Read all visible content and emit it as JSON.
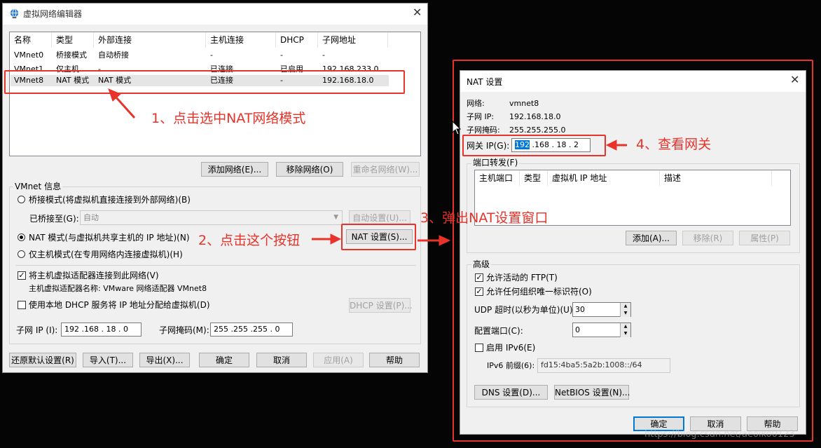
{
  "left_window": {
    "title": "虚拟网络编辑器",
    "columns": [
      "名称",
      "类型",
      "外部连接",
      "主机连接",
      "DHCP",
      "子网地址"
    ],
    "rows": [
      [
        "VMnet0",
        "桥接模式",
        "自动桥接",
        "-",
        "-",
        "-"
      ],
      [
        "VMnet1",
        "仅主机...",
        "-",
        "已连接",
        "已启用",
        "192.168.233.0"
      ],
      [
        "VMnet8",
        "NAT 模式",
        "NAT 模式",
        "已连接",
        "-",
        "192.168.18.0"
      ]
    ],
    "add_network": "添加网络(E)...",
    "remove_network": "移除网络(O)",
    "rename_network": "重命名网络(W)...",
    "vmnet_info": "VMnet 信息",
    "bridge_mode": "桥接模式(将虚拟机直接连接到外部网络)(B)",
    "bridged_to_label": "已桥接至(G):",
    "bridged_to_value": "自动",
    "auto_settings": "自动设置(U)...",
    "nat_mode": "NAT 模式(与虚拟机共享主机的 IP 地址)(N)",
    "nat_settings": "NAT 设置(S)...",
    "host_only": "仅主机模式(在专用网络内连接虚拟机)(H)",
    "connect_adapter": "将主机虚拟适配器连接到此网络(V)",
    "adapter_name": "主机虚拟适配器名称: VMware 网络适配器 VMnet8",
    "use_dhcp": "使用本地 DHCP 服务将 IP 地址分配给虚拟机(D)",
    "dhcp_settings": "DHCP 设置(P)...",
    "subnet_ip_label": "子网 IP (I):",
    "subnet_ip": "192 .168 . 18 . 0",
    "subnet_mask_label": "子网掩码(M):",
    "subnet_mask": "255 .255 .255 . 0",
    "restore": "还原默认设置(R)",
    "import": "导入(T)...",
    "export": "导出(X)...",
    "ok": "确定",
    "cancel": "取消",
    "apply": "应用(A)",
    "help": "帮助"
  },
  "nat_window": {
    "title": "NAT 设置",
    "network_label": "网络:",
    "network_value": "vmnet8",
    "subnet_ip_label": "子网 IP:",
    "subnet_ip_value": "192.168.18.0",
    "subnet_mask_label": "子网掩码:",
    "subnet_mask_value": "255.255.255.0",
    "gateway_label": "网关 IP(G):",
    "gateway_selected": "192",
    "gateway_rest": " .168 . 18  .  2",
    "port_forwarding": "端口转发(F)",
    "pf_columns": [
      "主机端口",
      "类型",
      "虚拟机 IP 地址",
      "描述"
    ],
    "add": "添加(A)...",
    "remove": "移除(R)",
    "properties": "属性(P)",
    "advanced": "高级",
    "allow_ftp": "允许活动的 FTP(T)",
    "allow_oui": "允许任何组织唯一标识符(O)",
    "udp_timeout_label": "UDP 超时(以秒为单位)(U):",
    "udp_timeout": "30",
    "config_port_label": "配置端口(C):",
    "config_port": "0",
    "enable_ipv6": "启用 IPv6(E)",
    "ipv6_prefix_label": "IPv6 前缀(6):",
    "ipv6_prefix": "fd15:4ba5:5a2b:1008::/64",
    "dns_settings": "DNS 设置(D)...",
    "netbios_settings": "NetBIOS 设置(N)...",
    "ok": "确定",
    "cancel": "取消",
    "help": "帮助"
  },
  "annotations": {
    "step1": "1、点击选中NAT网络模式",
    "step2": "2、点击这个按钮",
    "step3": "3、弹出NAT设置窗口",
    "step4": "4、查看网关"
  },
  "watermark": "https://blog.csdn.net/aeoiko0123",
  "colors": {
    "annotation_red": "#e8322a",
    "selection_blue": "#0078d7"
  }
}
